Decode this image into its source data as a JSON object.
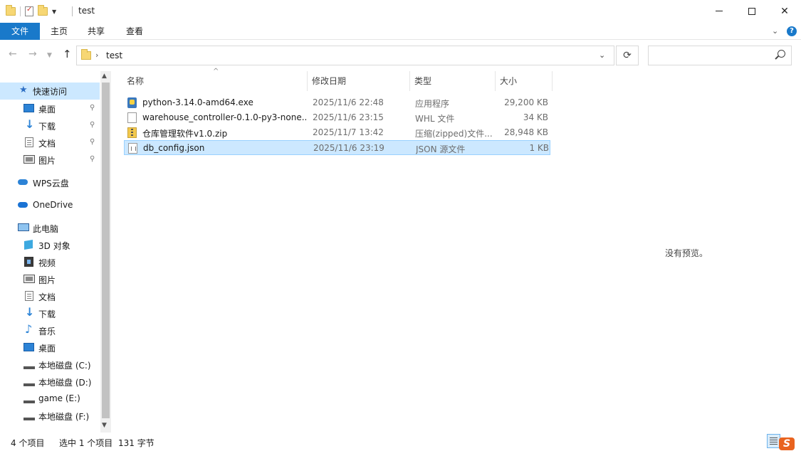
{
  "window": {
    "title": "test",
    "controls": {
      "minimize": "",
      "maximize": "",
      "close": "✕"
    }
  },
  "ribbon": {
    "tabs": [
      {
        "label": "文件"
      },
      {
        "label": "主页"
      },
      {
        "label": "共享"
      },
      {
        "label": "查看"
      }
    ],
    "help": "?"
  },
  "address": {
    "crumb": "test",
    "separator": "›"
  },
  "nav_buttons": {
    "back": "←",
    "forward": "→",
    "dropdown": "⌄",
    "up": "↑",
    "refresh": "⟳"
  },
  "search": {
    "placeholder": ""
  },
  "sidebar": {
    "items": [
      {
        "label": "快速访问",
        "icon": "star-icon"
      },
      {
        "label": "桌面",
        "icon": "desktop-icon",
        "pinned": true
      },
      {
        "label": "下载",
        "icon": "download-icon",
        "pinned": true
      },
      {
        "label": "文档",
        "icon": "document-icon",
        "pinned": true
      },
      {
        "label": "图片",
        "icon": "pictures-icon",
        "pinned": true
      },
      {
        "label": "WPS云盘",
        "icon": "cloud-icon"
      },
      {
        "label": "OneDrive",
        "icon": "onedrive-icon"
      },
      {
        "label": "此电脑",
        "icon": "computer-icon"
      },
      {
        "label": "3D 对象",
        "icon": "3d-objects-icon"
      },
      {
        "label": "视频",
        "icon": "video-icon"
      },
      {
        "label": "图片",
        "icon": "pictures-icon"
      },
      {
        "label": "文档",
        "icon": "document-icon"
      },
      {
        "label": "下载",
        "icon": "download-icon"
      },
      {
        "label": "音乐",
        "icon": "music-icon"
      },
      {
        "label": "桌面",
        "icon": "desktop-icon"
      },
      {
        "label": "本地磁盘 (C:)",
        "icon": "drive-icon"
      },
      {
        "label": "本地磁盘 (D:)",
        "icon": "drive-icon"
      },
      {
        "label": "game (E:)",
        "icon": "drive-icon"
      },
      {
        "label": "本地磁盘 (F:)",
        "icon": "drive-icon"
      }
    ],
    "pin_glyph": "📌"
  },
  "filelist": {
    "columns": [
      "名称",
      "修改日期",
      "类型",
      "大小"
    ],
    "sort_indicator": "^",
    "rows": [
      {
        "name": "python-3.14.0-amd64.exe",
        "date": "2025/11/6 22:48",
        "type": "应用程序",
        "size": "29,200 KB",
        "icon": "exe-icon"
      },
      {
        "name": "warehouse_controller-0.1.0-py3-none...",
        "date": "2025/11/6 23:15",
        "type": "WHL 文件",
        "size": "34 KB",
        "icon": "file-icon"
      },
      {
        "name": "仓库管理软件v1.0.zip",
        "date": "2025/11/7 13:42",
        "type": "压缩(zipped)文件...",
        "size": "28,948 KB",
        "icon": "zip-icon"
      },
      {
        "name": "db_config.json",
        "date": "2025/11/6 23:19",
        "type": "JSON 源文件",
        "size": "1 KB",
        "icon": "json-icon",
        "selected": true
      }
    ]
  },
  "preview": {
    "text": "没有预览。"
  },
  "status": {
    "count": "4 个项目",
    "selected": "选中 1 个项目",
    "bytes": "131 字节"
  },
  "colors": {
    "accent": "#1979ca",
    "selection": "#cce8ff",
    "selection_border": "#99d1ff"
  }
}
